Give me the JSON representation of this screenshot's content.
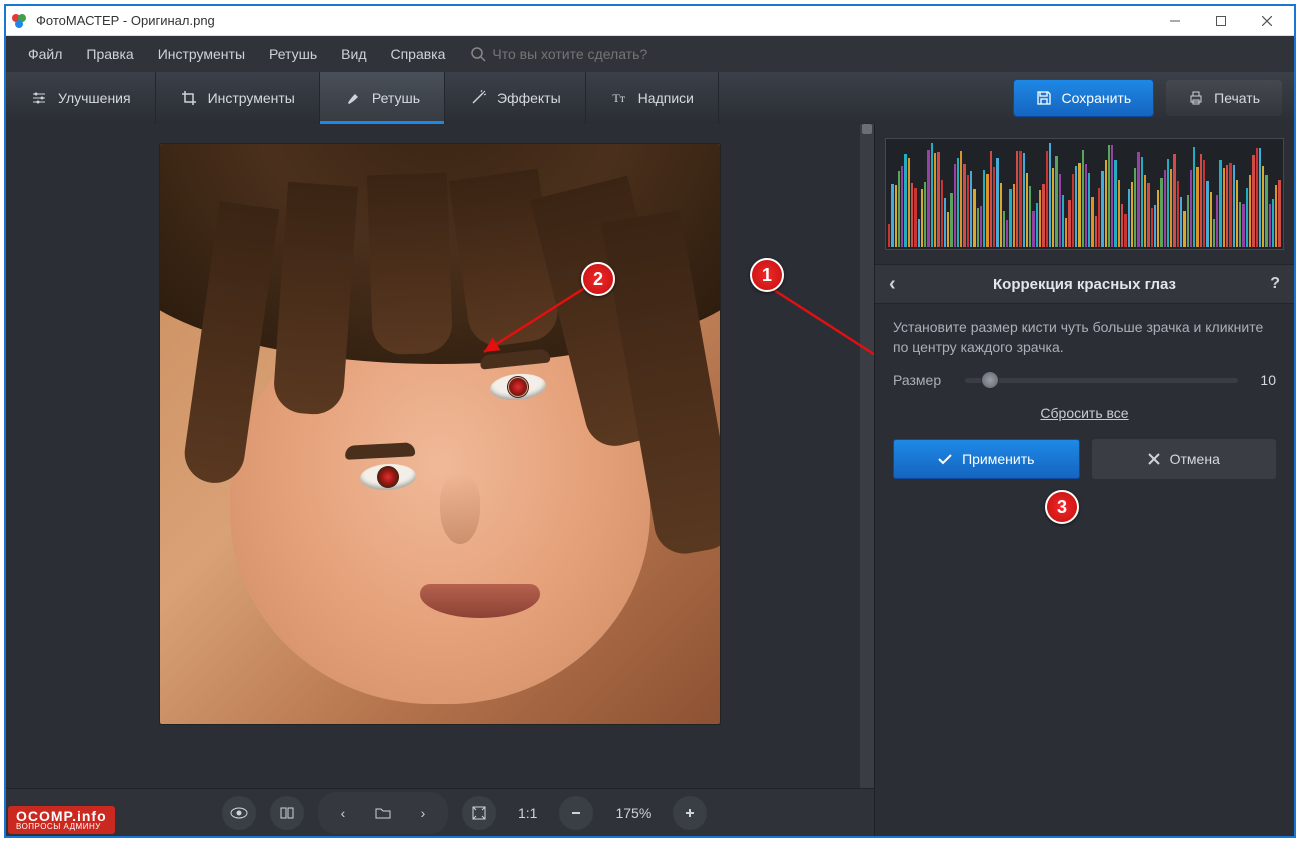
{
  "window": {
    "title": "ФотоМАСТЕР - Оригинал.png"
  },
  "menu": {
    "items": [
      "Файл",
      "Правка",
      "Инструменты",
      "Ретушь",
      "Вид",
      "Справка"
    ],
    "search_placeholder": "Что вы хотите сделать?"
  },
  "tabs": {
    "items": [
      {
        "label": "Улучшения",
        "icon": "sliders"
      },
      {
        "label": "Инструменты",
        "icon": "crop"
      },
      {
        "label": "Ретушь",
        "icon": "brush",
        "active": true
      },
      {
        "label": "Эффекты",
        "icon": "wand"
      },
      {
        "label": "Надписи",
        "icon": "text"
      }
    ]
  },
  "actions": {
    "save": "Сохранить",
    "print": "Печать"
  },
  "panel": {
    "title": "Коррекция красных глаз",
    "hint": "Установите размер кисти чуть больше зрачка и кликните по центру каждого зрачка.",
    "size_label": "Размер",
    "size_value": "10",
    "reset": "Сбросить все",
    "apply": "Применить",
    "cancel": "Отмена"
  },
  "status": {
    "ratio": "1:1",
    "zoom": "175%"
  },
  "brand": {
    "t1": "OCOMP.info",
    "t2": "ВОПРОСЫ АДМИНУ"
  },
  "annotations": {
    "b1": "1",
    "b2": "2",
    "b3": "3"
  }
}
